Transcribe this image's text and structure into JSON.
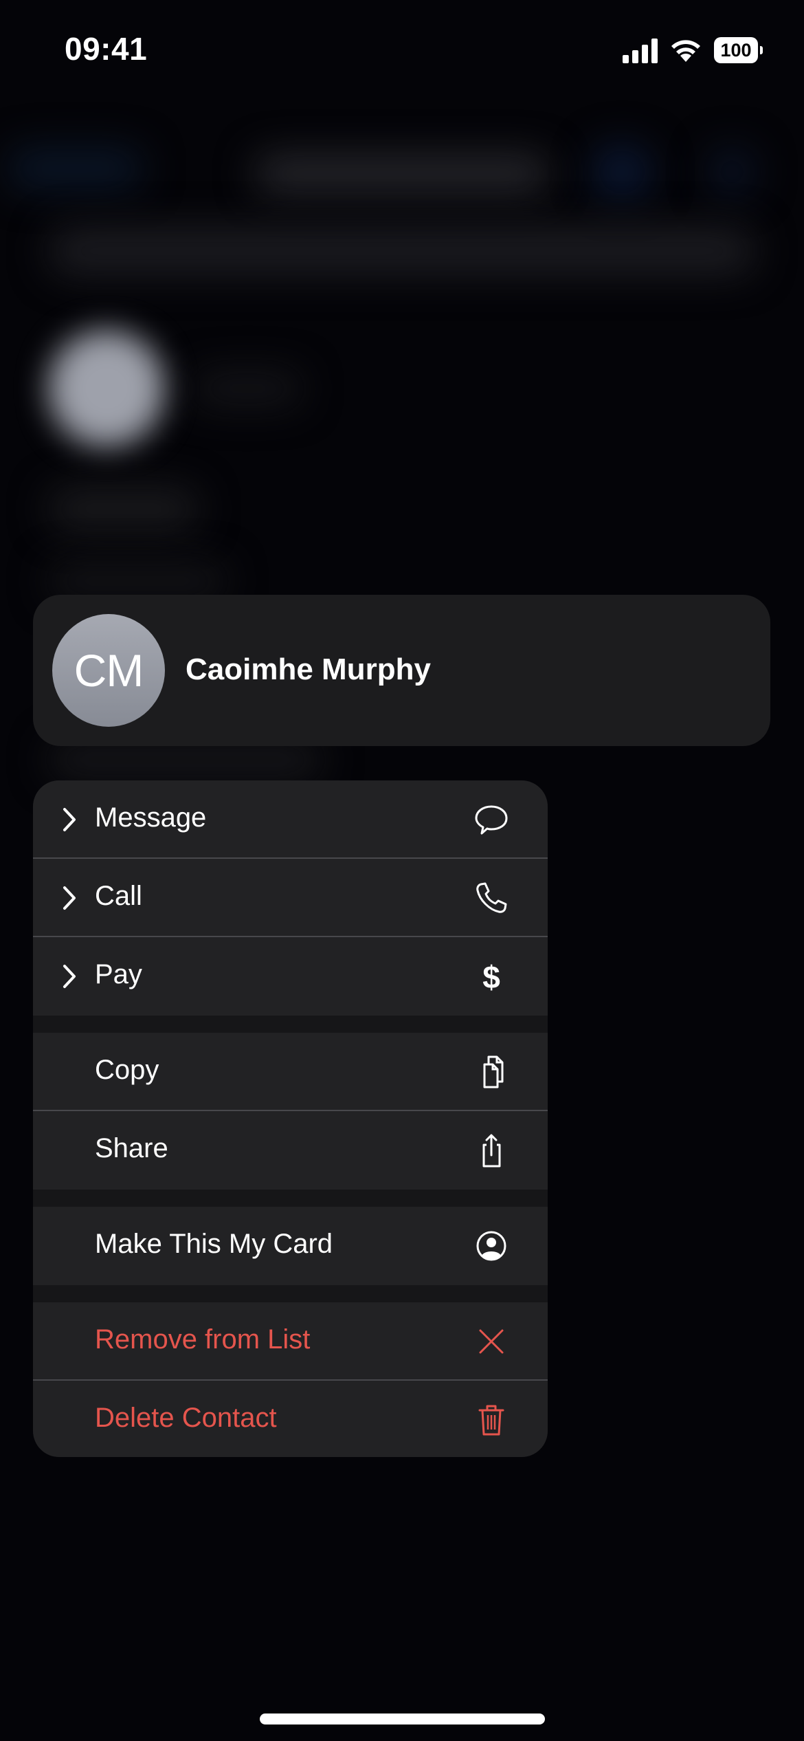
{
  "status_bar": {
    "time": "09:41",
    "battery_level": "100",
    "signal_bars": 4,
    "wifi": "full"
  },
  "contact_preview": {
    "initials": "CM",
    "name": "Caoimhe Murphy"
  },
  "menu": {
    "groups": [
      [
        {
          "label": "Message",
          "icon": "message-bubble-icon",
          "submenu": true,
          "destructive": false
        },
        {
          "label": "Call",
          "icon": "phone-icon",
          "submenu": true,
          "destructive": false
        },
        {
          "label": "Pay",
          "icon": "dollar-icon",
          "submenu": true,
          "destructive": false
        }
      ],
      [
        {
          "label": "Copy",
          "icon": "copy-icon",
          "submenu": false,
          "destructive": false
        },
        {
          "label": "Share",
          "icon": "share-icon",
          "submenu": false,
          "destructive": false
        }
      ],
      [
        {
          "label": "Make This My Card",
          "icon": "person-circle-icon",
          "submenu": false,
          "destructive": false
        }
      ],
      [
        {
          "label": "Remove from List",
          "icon": "x-mark-icon",
          "submenu": false,
          "destructive": true
        },
        {
          "label": "Delete Contact",
          "icon": "trash-icon",
          "submenu": false,
          "destructive": true
        }
      ]
    ]
  },
  "colors": {
    "destructive": "#e5554d",
    "menu_background": "#222224",
    "card_background": "#1c1c1e"
  }
}
